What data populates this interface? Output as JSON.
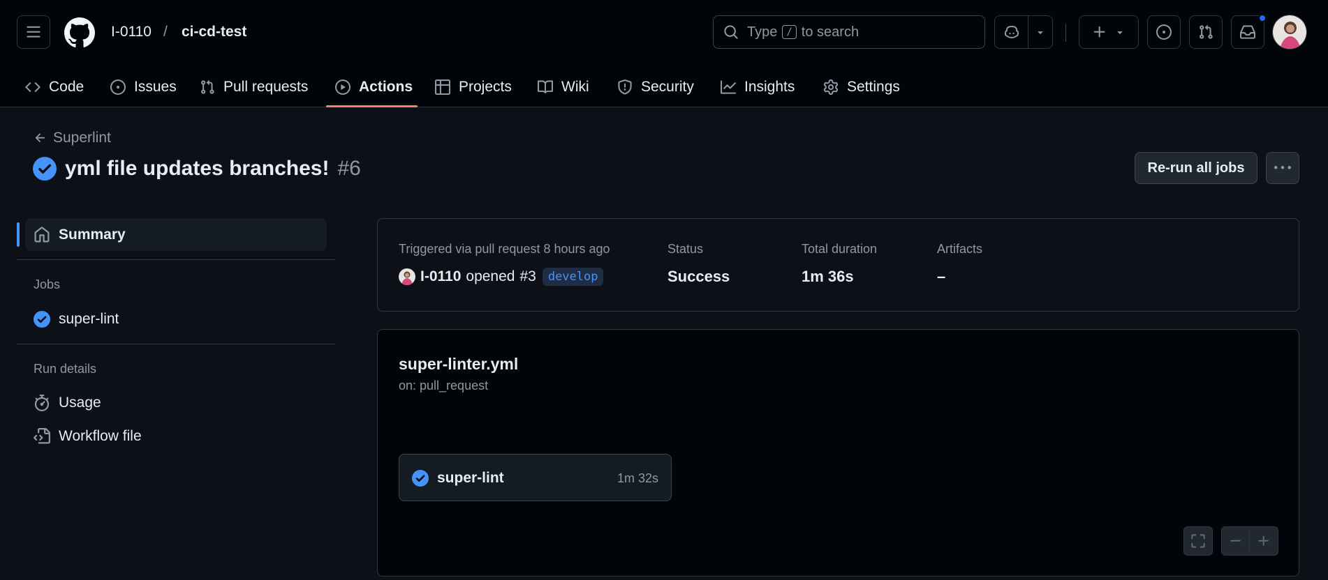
{
  "header": {
    "owner": "I-0110",
    "separator": "/",
    "repo": "ci-cd-test",
    "search": {
      "prefix": "Type",
      "key": "/",
      "suffix": "to search"
    }
  },
  "nav": {
    "tabs": [
      {
        "label": "Code",
        "icon": "code-icon"
      },
      {
        "label": "Issues",
        "icon": "issue-icon"
      },
      {
        "label": "Pull requests",
        "icon": "pull-request-icon"
      },
      {
        "label": "Actions",
        "icon": "play-icon",
        "active": true
      },
      {
        "label": "Projects",
        "icon": "table-icon"
      },
      {
        "label": "Wiki",
        "icon": "book-icon"
      },
      {
        "label": "Security",
        "icon": "shield-icon"
      },
      {
        "label": "Insights",
        "icon": "graph-icon"
      },
      {
        "label": "Settings",
        "icon": "gear-icon"
      }
    ]
  },
  "run": {
    "back_label": "Superlint",
    "title": "yml file updates branches!",
    "number": "#6",
    "rerun_label": "Re-run all jobs"
  },
  "sidebar": {
    "summary_label": "Summary",
    "jobs_heading": "Jobs",
    "jobs": [
      {
        "label": "super-lint"
      }
    ],
    "run_details_heading": "Run details",
    "details": [
      {
        "label": "Usage",
        "icon": "stopwatch-icon"
      },
      {
        "label": "Workflow file",
        "icon": "file-code-icon"
      }
    ]
  },
  "summary": {
    "trigger_label": "Triggered via pull request 8 hours ago",
    "actor": "I-0110",
    "action": "opened",
    "pr": "#3",
    "branch": "develop",
    "status_label": "Status",
    "status_value": "Success",
    "duration_label": "Total duration",
    "duration_value": "1m 36s",
    "artifacts_label": "Artifacts",
    "artifacts_value": "–"
  },
  "workflow": {
    "file": "super-linter.yml",
    "on": "on: pull_request",
    "job_name": "super-lint",
    "job_duration": "1m 32s"
  },
  "colors": {
    "accent": "#4493f8",
    "tab_underline": "#f78166",
    "success": "#4493f8"
  }
}
